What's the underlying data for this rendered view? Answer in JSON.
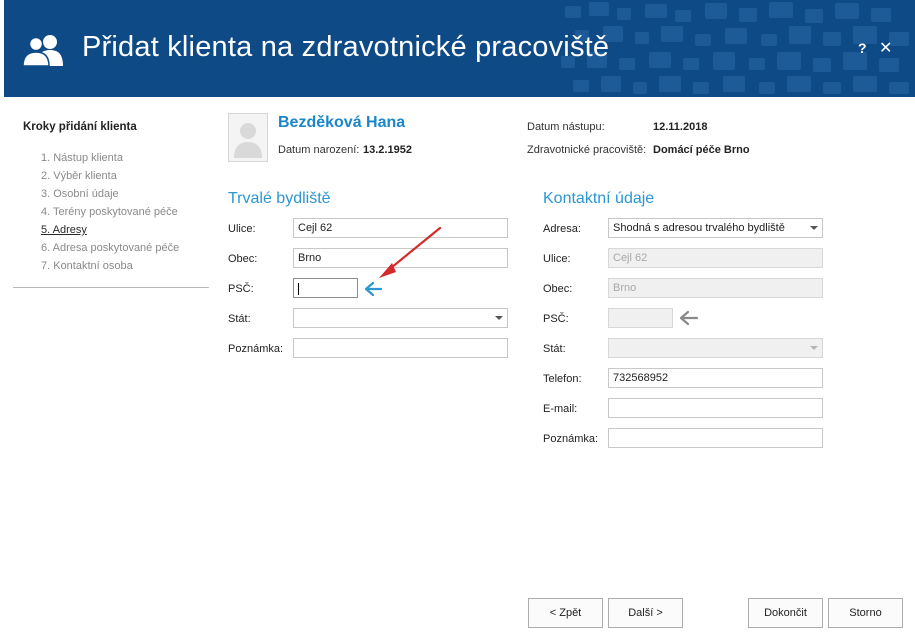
{
  "header": {
    "title": "Přidat klienta na zdravotnické pracoviště",
    "help_label": "?",
    "close_label": "✕",
    "icon": "users-icon",
    "background_color": "#0d4a86"
  },
  "steps": {
    "title": "Kroky přidání klienta",
    "items": [
      {
        "label": "1. Nástup klienta",
        "active": false
      },
      {
        "label": "2. Výběr klienta",
        "active": false
      },
      {
        "label": "3. Osobní údaje",
        "active": false
      },
      {
        "label": "4. Terény poskytované péče",
        "active": false
      },
      {
        "label": "5. Adresy",
        "active": true
      },
      {
        "label": "6. Adresa poskytované péče",
        "active": false
      },
      {
        "label": "7. Kontaktní osoba",
        "active": false
      }
    ]
  },
  "client": {
    "name": "Bezděková Hana",
    "birth_label": "Datum narození:",
    "birth_value": "13.2.1952",
    "start_label": "Datum nástupu:",
    "start_value": "12.11.2018",
    "workplace_label": "Zdravotnické pracoviště:",
    "workplace_value": "Domácí péče Brno"
  },
  "permanent": {
    "title": "Trvalé bydliště",
    "street_label": "Ulice:",
    "street_value": "Cejl 62",
    "city_label": "Obec:",
    "city_value": "Brno",
    "zip_label": "PSČ:",
    "zip_value": "",
    "country_label": "Stát:",
    "country_value": "",
    "note_label": "Poznámka:",
    "note_value": ""
  },
  "contact": {
    "title": "Kontaktní údaje",
    "address_label": "Adresa:",
    "address_value": "Shodná s adresou trvalého bydliště",
    "street_label": "Ulice:",
    "street_value": "Cejl 62",
    "city_label": "Obec:",
    "city_value": "Brno",
    "zip_label": "PSČ:",
    "zip_value": "",
    "country_label": "Stát:",
    "country_value": "",
    "phone_label": "Telefon:",
    "phone_value": "732568952",
    "email_label": "E-mail:",
    "email_value": "",
    "note_label": "Poznámka:",
    "note_value": ""
  },
  "buttons": {
    "back": "< Zpět",
    "next": "Další >",
    "finish": "Dokončit",
    "cancel": "Storno"
  },
  "colors": {
    "accent": "#2b96d2",
    "annotation_arrow": "#d42a2a",
    "hint_arrow_blue": "#2b96d2",
    "hint_arrow_gray": "#8a8a8a"
  }
}
